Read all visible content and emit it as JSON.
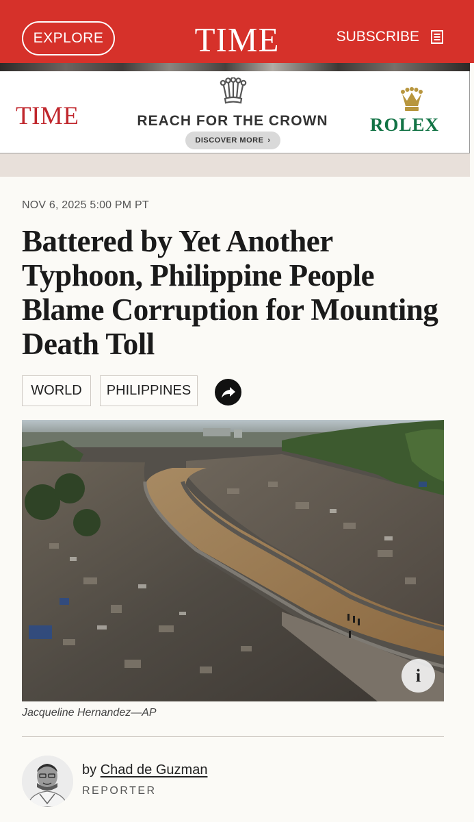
{
  "header": {
    "explore_label": "EXPLORE",
    "brand": "TIME",
    "subscribe_label": "SUBSCRIBE"
  },
  "ad": {
    "time_logo": "TIME",
    "headline": "REACH FOR THE CROWN",
    "cta": "DISCOVER MORE",
    "sponsor": "ROLEX"
  },
  "article": {
    "dateline": "NOV 6, 2025 5:00 PM PT",
    "headline": "Battered by Yet Another Typhoon, Philippine People Blame Corruption for Mounting Death Toll",
    "tags": [
      "WORLD",
      "PHILIPPINES"
    ],
    "photo_credit": "Jacqueline Hernandez—AP",
    "info_label": "i",
    "byline_prefix": "by",
    "author": "Chad de Guzman",
    "author_role": "REPORTER"
  },
  "icons": {
    "share": "share-arrow-icon",
    "subscribe": "newspaper-icon",
    "ad_crown": "crown-icon",
    "info": "info-icon"
  },
  "colors": {
    "header_red": "#d6312a",
    "ad_time_red": "#c0272d",
    "rolex_green": "#127345",
    "rolex_gold": "#b8963e",
    "page_bg": "#fbfaf6"
  }
}
